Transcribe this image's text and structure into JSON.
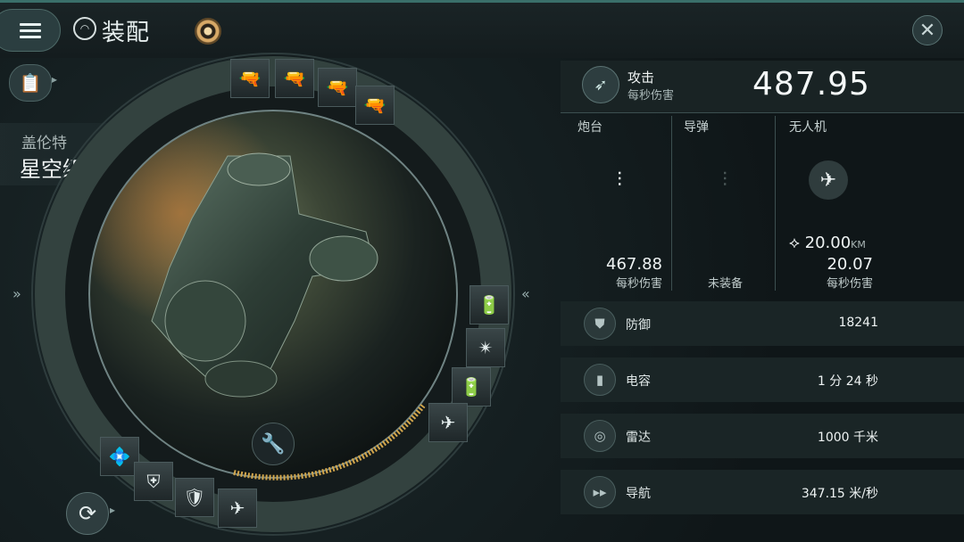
{
  "header": {
    "title": "装配",
    "menu_icon": "hamburger-menu-icon",
    "close_icon": "close-icon"
  },
  "ship": {
    "class": "盖伦特",
    "name": "星空级隐匿型"
  },
  "attack": {
    "label": "攻击",
    "sublabel": "每秒伤害",
    "value": "487.95"
  },
  "weapons": {
    "turret": {
      "title": "炮台",
      "value": "467.88",
      "unit": "每秒伤害"
    },
    "missile": {
      "title": "导弹",
      "status": "未装备"
    },
    "drone": {
      "title": "无人机",
      "range": "20.00",
      "range_unit": "KM",
      "value": "20.07",
      "unit": "每秒伤害"
    }
  },
  "stats": [
    {
      "label": "防御",
      "value": "18241",
      "icon": "shield-icon"
    },
    {
      "label": "电容",
      "value": "1 分 24 秒",
      "icon": "capacitor-icon"
    },
    {
      "label": "雷达",
      "value": "1000 千米",
      "icon": "radar-icon"
    },
    {
      "label": "导航",
      "value": "347.15 米/秒",
      "icon": "navigation-icon"
    }
  ],
  "colors": {
    "accent": "#3a6f6a",
    "capacitor_bar": "#d2a64c"
  }
}
